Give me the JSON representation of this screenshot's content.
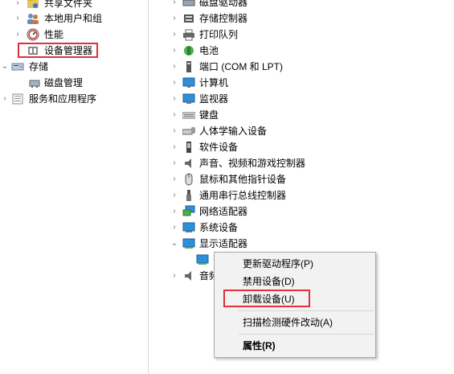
{
  "left_tree": [
    {
      "label": "共享文件夹",
      "icon": "shared-folder-icon",
      "expander": "›"
    },
    {
      "label": "本地用户和组",
      "icon": "users-icon",
      "expander": "›"
    },
    {
      "label": "性能",
      "icon": "performance-icon",
      "expander": "›"
    },
    {
      "label": "设备管理器",
      "icon": "device-manager-icon",
      "expander": ""
    },
    {
      "label": "存储",
      "icon": "storage-icon",
      "expander": "⌄"
    },
    {
      "label": "磁盘管理",
      "icon": "disk-management-icon",
      "expander": ""
    },
    {
      "label": "服务和应用程序",
      "icon": "services-icon",
      "expander": "›"
    }
  ],
  "device_tree": [
    {
      "label": "磁盘驱动器",
      "icon": "disk-drive-icon",
      "expander": "›"
    },
    {
      "label": "存储控制器",
      "icon": "storage-controller-icon",
      "expander": "›"
    },
    {
      "label": "打印队列",
      "icon": "printer-icon",
      "expander": "›"
    },
    {
      "label": "电池",
      "icon": "battery-icon",
      "expander": "›"
    },
    {
      "label": "端口 (COM 和 LPT)",
      "icon": "port-icon",
      "expander": "›"
    },
    {
      "label": "计算机",
      "icon": "computer-icon",
      "expander": "›"
    },
    {
      "label": "监视器",
      "icon": "monitor-icon",
      "expander": "›"
    },
    {
      "label": "键盘",
      "icon": "keyboard-icon",
      "expander": "›"
    },
    {
      "label": "人体学输入设备",
      "icon": "hid-icon",
      "expander": "›"
    },
    {
      "label": "软件设备",
      "icon": "software-device-icon",
      "expander": "›"
    },
    {
      "label": "声音、视频和游戏控制器",
      "icon": "sound-icon",
      "expander": "›"
    },
    {
      "label": "鼠标和其他指针设备",
      "icon": "mouse-icon",
      "expander": "›"
    },
    {
      "label": "通用串行总线控制器",
      "icon": "usb-icon",
      "expander": "›"
    },
    {
      "label": "网络适配器",
      "icon": "network-icon",
      "expander": "›"
    },
    {
      "label": "系统设备",
      "icon": "system-device-icon",
      "expander": "›"
    },
    {
      "label": "显示适配器",
      "icon": "display-adapter-icon",
      "expander": "⌄"
    }
  ],
  "display_child": {
    "label": "",
    "icon": "display-adapter-device-icon"
  },
  "partial_row": {
    "label": "音频",
    "icon": "audio-icon",
    "expander": "›"
  },
  "context_menu": {
    "update_driver": "更新驱动程序(P)",
    "disable": "禁用设备(D)",
    "uninstall": "卸载设备(U)",
    "scan": "扫描检测硬件改动(A)",
    "properties": "属性(R)"
  },
  "colors": {
    "highlight": "#e0303a",
    "menu_bg": "#f2f2f2",
    "icon_blue": "#2f8fd8"
  }
}
